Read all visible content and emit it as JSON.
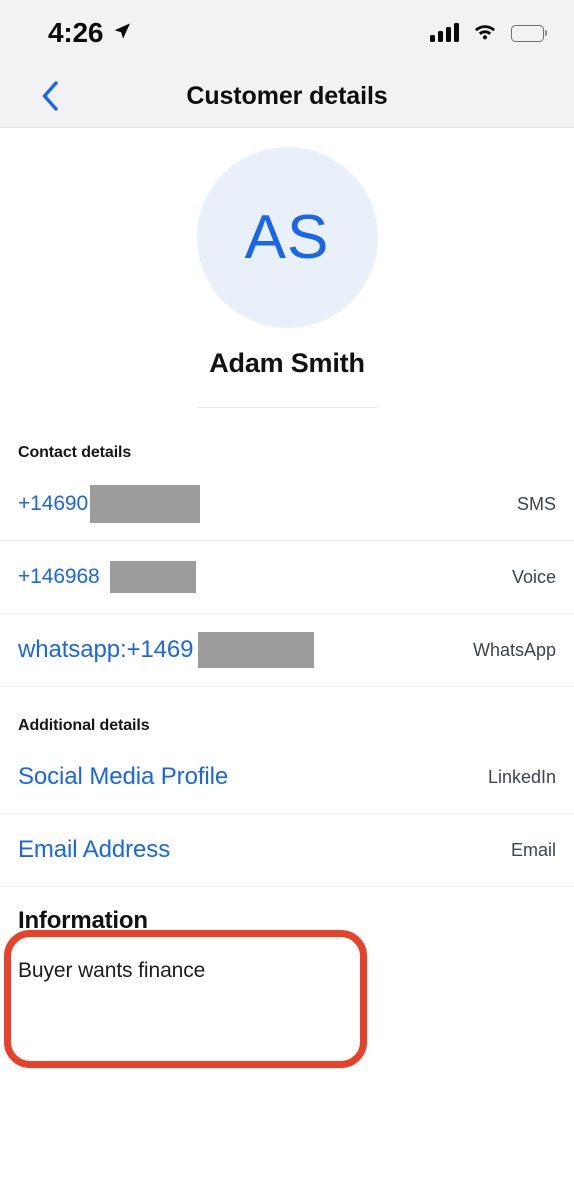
{
  "status_bar": {
    "time": "4:26",
    "location_icon": "location-arrow-icon",
    "cellular_icon": "cellular-signal-icon",
    "wifi_icon": "wifi-icon",
    "battery_icon": "battery-full-icon"
  },
  "nav": {
    "back_icon": "chevron-left-icon",
    "title": "Customer details"
  },
  "profile": {
    "initials": "AS",
    "name": "Adam Smith"
  },
  "contact_section": {
    "header": "Contact details",
    "rows": [
      {
        "value": "+14690",
        "kind": "SMS"
      },
      {
        "value": "+146968",
        "kind": "Voice"
      },
      {
        "value": "whatsapp:+1469",
        "kind": "WhatsApp"
      }
    ]
  },
  "additional_section": {
    "header": "Additional details",
    "rows": [
      {
        "value": "Social Media Profile",
        "kind": "LinkedIn"
      },
      {
        "value": "Email Address",
        "kind": "Email"
      }
    ]
  },
  "information": {
    "title": "Information",
    "body": "Buyer wants finance"
  },
  "colors": {
    "link_blue": "#1a66e8",
    "header_bg": "#f2f2f4",
    "avatar_bg": "#e9f0fa",
    "redaction_gray": "#9c9c9c",
    "highlight_red": "#e8402a"
  }
}
